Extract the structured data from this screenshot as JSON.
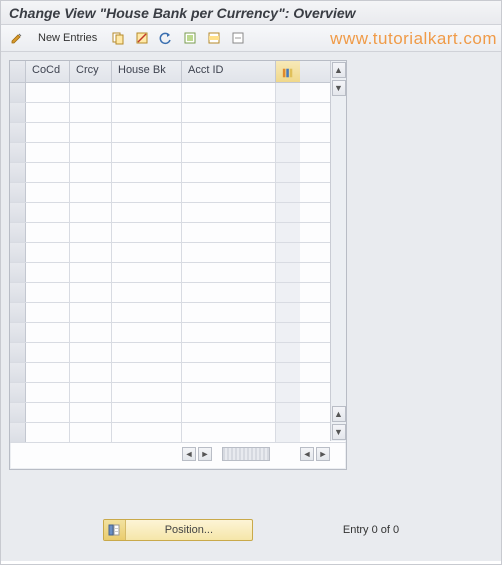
{
  "header": {
    "title": "Change View \"House Bank per Currency\": Overview",
    "watermark": "www.tutorialkart.com"
  },
  "toolbar": {
    "new_entries": "New Entries"
  },
  "table": {
    "columns": [
      "CoCd",
      "Crcy",
      "House Bk",
      "Acct ID"
    ],
    "visible_rows": 18,
    "rows": []
  },
  "footer": {
    "position_label": "Position...",
    "entry_text": "Entry 0 of 0"
  }
}
